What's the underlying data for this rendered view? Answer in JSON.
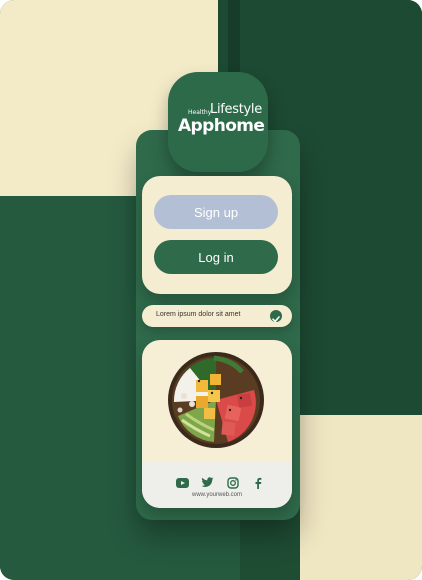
{
  "logo": {
    "small_text": "Healthy",
    "lifestyle_text": "Lifestyle",
    "name": "Apphome"
  },
  "auth": {
    "signup_label": "Sign up",
    "login_label": "Log in"
  },
  "check_row": {
    "text": "Lorem ipsum dolor sit amet",
    "checked": true
  },
  "food": {
    "image": "poke-bowl-image"
  },
  "social": {
    "icons": [
      "youtube-icon",
      "twitter-icon",
      "instagram-icon",
      "facebook-icon"
    ],
    "website": "www.yourweb.com"
  },
  "colors": {
    "brand_green": "#2f6a4b",
    "dark_green": "#1d4a33",
    "cream": "#f5edd1",
    "signup_blue": "#b3bfd4"
  }
}
